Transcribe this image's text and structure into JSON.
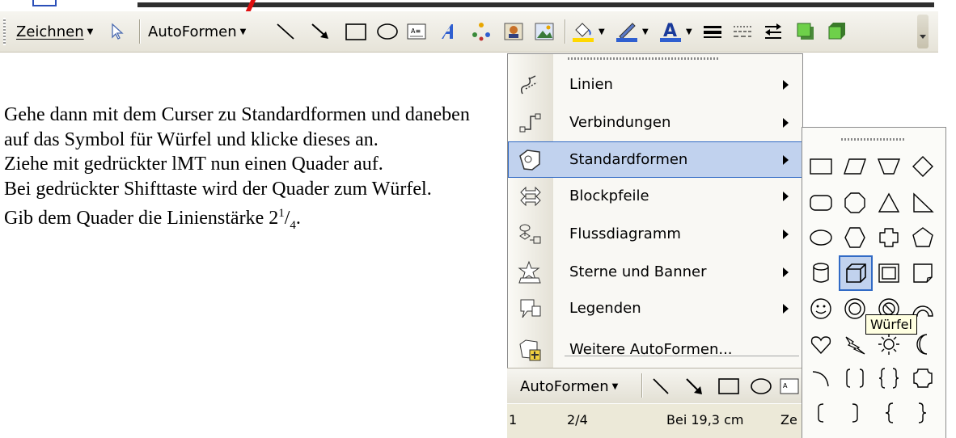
{
  "toolbar": {
    "draw_label": "Zeichnen",
    "autoshapes_label": "AutoFormen"
  },
  "document": {
    "paragraphs": [
      "Gehe dann mit dem Curser zu Standardformen und daneben auf das Symbol für Würfel und klicke dieses an.",
      "Ziehe mit gedrückter lMT nun einen Quader auf.",
      "Bei gedrückter Shifttaste wird der Quader zum Würfel."
    ],
    "last_line_prefix": "Gib dem Quader die Linienstärke 2",
    "fraction_numerator": "1",
    "fraction_slash": "/",
    "fraction_denominator": "4",
    "last_line_suffix": "."
  },
  "menu": {
    "items": [
      {
        "label": "Linien",
        "icon": "lines-icon"
      },
      {
        "label": "Verbindungen",
        "icon": "connectors-icon"
      },
      {
        "label": "Standardformen",
        "icon": "basic-shapes-icon"
      },
      {
        "label": "Blockpfeile",
        "icon": "block-arrows-icon"
      },
      {
        "label": "Flussdiagramm",
        "icon": "flowchart-icon"
      },
      {
        "label": "Sterne und Banner",
        "icon": "stars-banners-icon"
      },
      {
        "label": "Legenden",
        "icon": "callouts-icon"
      },
      {
        "label": "Weitere AutoFormen...",
        "icon": "more-autoshapes-icon"
      }
    ],
    "highlighted": "Standardformen"
  },
  "minibar": {
    "autoshapes_label": "AutoFormen"
  },
  "status": {
    "page_frag": "1",
    "pages": "2/4",
    "position": "Bei 19,3 cm",
    "line_frag": "Ze"
  },
  "palette": {
    "tooltip": "Würfel",
    "selected": "cube"
  },
  "colors": {
    "highlight": "#c1d2ee",
    "highlight_border": "#316ac5",
    "arrow": "#e01010",
    "tooltip_bg": "#ffffe1"
  }
}
